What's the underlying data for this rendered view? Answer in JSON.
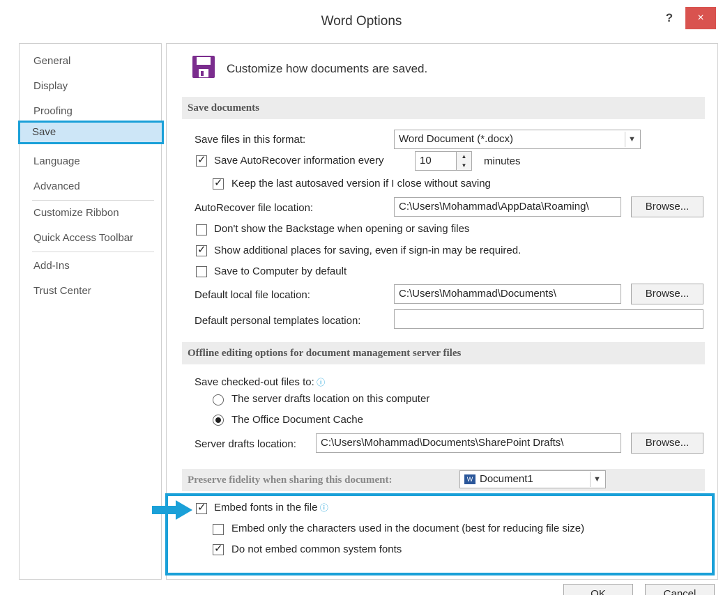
{
  "window": {
    "title": "Word Options",
    "help_label": "?",
    "close_label": "×"
  },
  "nav": {
    "items": [
      {
        "label": "General"
      },
      {
        "label": "Display"
      },
      {
        "label": "Proofing"
      },
      {
        "label": "Save"
      },
      {
        "label": "Language"
      },
      {
        "label": "Advanced"
      },
      {
        "label": "Customize Ribbon"
      },
      {
        "label": "Quick Access Toolbar"
      },
      {
        "label": "Add-Ins"
      },
      {
        "label": "Trust Center"
      }
    ],
    "selected": "Save"
  },
  "header": {
    "icon": "floppy-disk-icon",
    "text": "Customize how documents are saved."
  },
  "save_documents": {
    "heading": "Save documents",
    "format_label": "Save files in this format:",
    "format_value": "Word Document (*.docx)",
    "autorecover_label": "Save AutoRecover information every",
    "autorecover_checked": true,
    "autorecover_minutes": "10",
    "minutes_label": "minutes",
    "keep_last_label": "Keep the last autosaved version if I close without saving",
    "keep_last_checked": true,
    "autorecover_location_label": "AutoRecover file location:",
    "autorecover_location_value": "C:\\Users\\Mohammad\\AppData\\Roaming\\",
    "browse_label": "Browse...",
    "dont_show_backstage_label": "Don't show the Backstage when opening or saving files",
    "dont_show_backstage_checked": false,
    "show_additional_label": "Show additional places for saving, even if sign-in may be required.",
    "show_additional_checked": true,
    "save_to_computer_label": "Save to Computer by default",
    "save_to_computer_checked": false,
    "default_local_label": "Default local file location:",
    "default_local_value": "C:\\Users\\Mohammad\\Documents\\",
    "default_templates_label": "Default personal templates location:",
    "default_templates_value": ""
  },
  "offline": {
    "heading": "Offline editing options for document management server files",
    "save_checked_out_label": "Save checked-out files to:",
    "option_server_label": "The server drafts location on this computer",
    "option_cache_label": "The Office Document Cache",
    "selected_option": "cache",
    "server_drafts_label": "Server drafts location:",
    "server_drafts_value": "C:\\Users\\Mohammad\\Documents\\SharePoint Drafts\\",
    "browse_label": "Browse..."
  },
  "fidelity": {
    "heading": "Preserve fidelity when sharing this document:",
    "document_value": "Document1",
    "embed_fonts_label": "Embed fonts in the file",
    "embed_fonts_checked": true,
    "embed_only_label": "Embed only the characters used in the document (best for reducing file size)",
    "embed_only_checked": false,
    "do_not_embed_label": "Do not embed common system fonts",
    "do_not_embed_checked": true
  },
  "footer": {
    "ok_label": "OK",
    "cancel_label": "Cancel"
  },
  "colors": {
    "accent": "#1aa0d8",
    "close": "#d9534f",
    "save_icon": "#7b2d8e"
  }
}
